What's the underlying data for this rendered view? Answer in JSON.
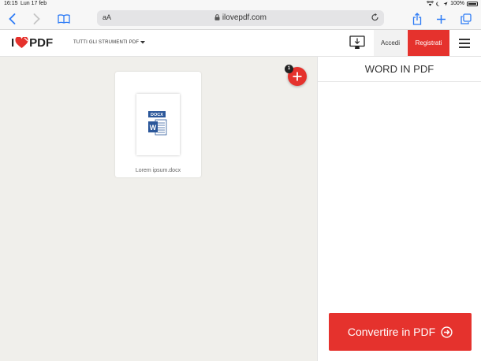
{
  "status_bar": {
    "time": "16:15",
    "date": "Lun 17 feb",
    "battery": "100%"
  },
  "browser": {
    "aa_label": "aA",
    "url": "ilovepdf.com"
  },
  "header": {
    "logo_i": "I",
    "logo_pdf": "PDF",
    "tools_menu": "TUTTI GLI STRUMENTI PDF",
    "login": "Accedi",
    "signup": "Registrati"
  },
  "workspace": {
    "file": {
      "type": "DOCX",
      "name": "Lorem ipsum.docx"
    },
    "file_count": "1"
  },
  "sidebar": {
    "title": "WORD IN PDF",
    "convert": "Convertire in PDF"
  },
  "colors": {
    "brand_red": "#e5322d",
    "safari_blue": "#2d7bf6",
    "word_blue": "#2b579a"
  }
}
